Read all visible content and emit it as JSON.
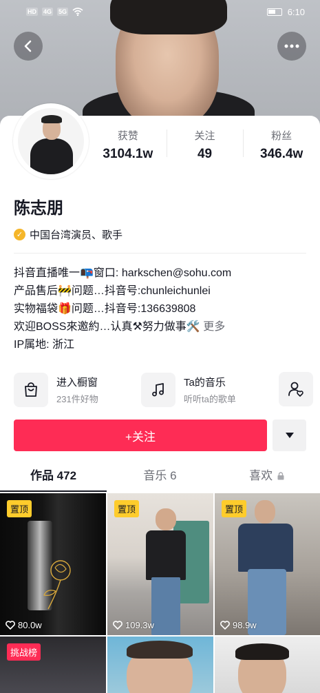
{
  "status_bar": {
    "left": [
      "HD",
      "4G",
      "5G"
    ],
    "time": "6:10"
  },
  "header": {
    "back_icon": "chevron-left-icon",
    "more_icon": "more-horizontal-icon"
  },
  "stats": [
    {
      "label": "获赞",
      "value": "3104.1w"
    },
    {
      "label": "关注",
      "value": "49"
    },
    {
      "label": "粉丝",
      "value": "346.4w"
    }
  ],
  "profile": {
    "name": "陈志朋",
    "verification": "中国台湾演员、歌手",
    "bio": [
      "抖音直播唯一📭窗口:  harkschen@sohu.com",
      "产品售后🚧问题…抖音号:chunleichunlei",
      "实物福袋🎁问题…抖音号:136639808",
      "欢迎BOSS來邀約…认真⚒努力做事🛠️"
    ],
    "bio_more": "更多",
    "ip": "IP属地:  浙江"
  },
  "shortcuts": [
    {
      "title": "进入橱窗",
      "sub": "231件好物",
      "icon": "shopping-bag-icon"
    },
    {
      "title": "Ta的音乐",
      "sub": "听听ta的歌单",
      "icon": "music-note-icon"
    }
  ],
  "follow": {
    "label": "+关注"
  },
  "tabs": [
    {
      "label": "作品 472"
    },
    {
      "label": "音乐 6"
    },
    {
      "label": "喜欢"
    }
  ],
  "videos": [
    {
      "badge": "置顶",
      "likes": "80.0w"
    },
    {
      "badge": "置顶",
      "likes": "109.3w"
    },
    {
      "badge": "置顶",
      "likes": "98.9w"
    },
    {
      "badge": "挑战榜",
      "likes": ""
    },
    {
      "badge": "",
      "likes": ""
    },
    {
      "badge": "",
      "likes": ""
    }
  ],
  "colors": {
    "accent": "#fe2c55",
    "pin": "#fecc2c",
    "verified": "#f5b62a"
  }
}
